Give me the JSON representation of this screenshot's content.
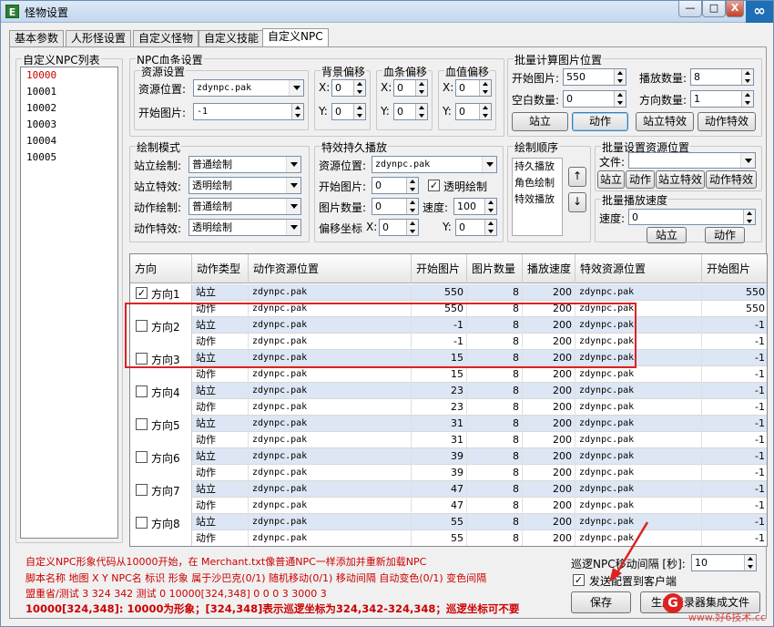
{
  "window": {
    "title": "怪物设置",
    "app_icon": "E",
    "btn_min": "—",
    "btn_max": "□",
    "btn_close": "X",
    "corner_glyph": "∞"
  },
  "tabs": [
    "基本参数",
    "人形怪设置",
    "自定义怪物",
    "自定义技能",
    "自定义NPC"
  ],
  "npc_list": {
    "label": "自定义NPC列表",
    "items": [
      "10000",
      "10001",
      "10002",
      "10003",
      "10004",
      "10005"
    ],
    "selected": "10000"
  },
  "hp_bar": {
    "label": "NPC血条设置",
    "resource": {
      "label": "资源设置",
      "pos_label": "资源位置:",
      "pos_value": "zdynpc.pak",
      "start_label": "开始图片:",
      "start_value": "-1"
    },
    "bg_offset": {
      "label": "背景偏移",
      "x_label": "X:",
      "x": "0",
      "y_label": "Y:",
      "y": "0"
    },
    "bar_offset": {
      "label": "血条偏移",
      "x_label": "X:",
      "x": "0",
      "y_label": "Y:",
      "y": "0"
    },
    "val_offset": {
      "label": "血值偏移",
      "x_label": "X:",
      "x": "0",
      "y_label": "Y:",
      "y": "0"
    }
  },
  "batch_calc": {
    "label": "批量计算图片位置",
    "start_label": "开始图片:",
    "start": "550",
    "play_label": "播放数量:",
    "play": "8",
    "blank_label": "空白数量:",
    "blank": "0",
    "dir_label": "方向数量:",
    "dir": "1",
    "btn_stand": "站立",
    "btn_action": "动作",
    "btn_stand_fx": "站立特效",
    "btn_action_fx": "动作特效"
  },
  "draw_mode": {
    "label": "绘制模式",
    "rows": [
      {
        "label": "站立绘制:",
        "value": "普通绘制"
      },
      {
        "label": "站立特效:",
        "value": "透明绘制"
      },
      {
        "label": "动作绘制:",
        "value": "普通绘制"
      },
      {
        "label": "动作特效:",
        "value": "透明绘制"
      }
    ]
  },
  "fx_play": {
    "label": "特效持久播放",
    "pos_label": "资源位置:",
    "pos_value": "zdynpc.pak",
    "start_label": "开始图片:",
    "start": "0",
    "transparent_label": "透明绘制",
    "transparent_checked": true,
    "count_label": "图片数量:",
    "count": "0",
    "speed_label": "速度:",
    "speed": "100",
    "offset_label": "偏移坐标",
    "x_label": "X:",
    "x": "0",
    "y_label": "Y:",
    "y": "0"
  },
  "draw_order": {
    "label": "绘制顺序",
    "items": [
      "持久播放",
      "角色绘制",
      "特效播放"
    ],
    "up": "↑",
    "down": "↓"
  },
  "batch_res": {
    "label": "批量设置资源位置",
    "file_label": "文件:",
    "file_value": "",
    "btn_stand": "站立",
    "btn_action": "动作",
    "btn_stand_fx": "站立特效",
    "btn_action_fx": "动作特效"
  },
  "batch_speed": {
    "label": "批量播放速度",
    "speed_label": "速度:",
    "speed": "0",
    "btn_stand": "站立",
    "btn_action": "动作"
  },
  "table": {
    "headers": [
      "方向",
      "动作类型",
      "动作资源位置",
      "开始图片",
      "图片数量",
      "播放速度",
      "特效资源位置",
      "开始图片"
    ],
    "directions": [
      {
        "name": "方向1",
        "checked": true,
        "rows": [
          {
            "type": "站立",
            "res": "zdynpc.pak",
            "start": "550",
            "count": "8",
            "speed": "200",
            "fx_res": "zdynpc.pak",
            "fx_start": "550"
          },
          {
            "type": "动作",
            "res": "zdynpc.pak",
            "start": "550",
            "count": "8",
            "speed": "200",
            "fx_res": "zdynpc.pak",
            "fx_start": "550"
          }
        ]
      },
      {
        "name": "方向2",
        "checked": false,
        "rows": [
          {
            "type": "站立",
            "res": "zdynpc.pak",
            "start": "-1",
            "count": "8",
            "speed": "200",
            "fx_res": "zdynpc.pak",
            "fx_start": "-1"
          },
          {
            "type": "动作",
            "res": "zdynpc.pak",
            "start": "-1",
            "count": "8",
            "speed": "200",
            "fx_res": "zdynpc.pak",
            "fx_start": "-1"
          }
        ]
      },
      {
        "name": "方向3",
        "checked": false,
        "rows": [
          {
            "type": "站立",
            "res": "zdynpc.pak",
            "start": "15",
            "count": "8",
            "speed": "200",
            "fx_res": "zdynpc.pak",
            "fx_start": "-1"
          },
          {
            "type": "动作",
            "res": "zdynpc.pak",
            "start": "15",
            "count": "8",
            "speed": "200",
            "fx_res": "zdynpc.pak",
            "fx_start": "-1"
          }
        ]
      },
      {
        "name": "方向4",
        "checked": false,
        "rows": [
          {
            "type": "站立",
            "res": "zdynpc.pak",
            "start": "23",
            "count": "8",
            "speed": "200",
            "fx_res": "zdynpc.pak",
            "fx_start": "-1"
          },
          {
            "type": "动作",
            "res": "zdynpc.pak",
            "start": "23",
            "count": "8",
            "speed": "200",
            "fx_res": "zdynpc.pak",
            "fx_start": "-1"
          }
        ]
      },
      {
        "name": "方向5",
        "checked": false,
        "rows": [
          {
            "type": "站立",
            "res": "zdynpc.pak",
            "start": "31",
            "count": "8",
            "speed": "200",
            "fx_res": "zdynpc.pak",
            "fx_start": "-1"
          },
          {
            "type": "动作",
            "res": "zdynpc.pak",
            "start": "31",
            "count": "8",
            "speed": "200",
            "fx_res": "zdynpc.pak",
            "fx_start": "-1"
          }
        ]
      },
      {
        "name": "方向6",
        "checked": false,
        "rows": [
          {
            "type": "站立",
            "res": "zdynpc.pak",
            "start": "39",
            "count": "8",
            "speed": "200",
            "fx_res": "zdynpc.pak",
            "fx_start": "-1"
          },
          {
            "type": "动作",
            "res": "zdynpc.pak",
            "start": "39",
            "count": "8",
            "speed": "200",
            "fx_res": "zdynpc.pak",
            "fx_start": "-1"
          }
        ]
      },
      {
        "name": "方向7",
        "checked": false,
        "rows": [
          {
            "type": "站立",
            "res": "zdynpc.pak",
            "start": "47",
            "count": "8",
            "speed": "200",
            "fx_res": "zdynpc.pak",
            "fx_start": "-1"
          },
          {
            "type": "动作",
            "res": "zdynpc.pak",
            "start": "47",
            "count": "8",
            "speed": "200",
            "fx_res": "zdynpc.pak",
            "fx_start": "-1"
          }
        ]
      },
      {
        "name": "方向8",
        "checked": false,
        "rows": [
          {
            "type": "站立",
            "res": "zdynpc.pak",
            "start": "55",
            "count": "8",
            "speed": "200",
            "fx_res": "zdynpc.pak",
            "fx_start": "-1"
          },
          {
            "type": "动作",
            "res": "zdynpc.pak",
            "start": "55",
            "count": "8",
            "speed": "200",
            "fx_res": "zdynpc.pak",
            "fx_start": "-1"
          }
        ]
      }
    ]
  },
  "info": [
    "自定义NPC形象代码从10000开始，在 Merchant.txt像普通NPC一样添加并重新加载NPC",
    "脚本名称 地图 X Y NPC名 标识 形象 属于沙巴克(0/1) 随机移动(0/1) 移动间隔 自动变色(0/1) 变色间隔",
    "盟重省/测试 3 324 342 测试 0 10000[324,348] 0 0 0 3 3000 3",
    "10000[324,348]: 10000为形象；[324,348]表示巡逻坐标为324,342-324,348；巡逻坐标可不要"
  ],
  "patrol": {
    "label": "巡逻NPC移动间隔 [秒]:",
    "value": "10",
    "send_label": "发送配置到客户端",
    "send_checked": true
  },
  "btn_save": "保存",
  "btn_gen": "生成登录器集成文件",
  "logo_glyph": "G",
  "watermark": "www.好6技术.cc"
}
